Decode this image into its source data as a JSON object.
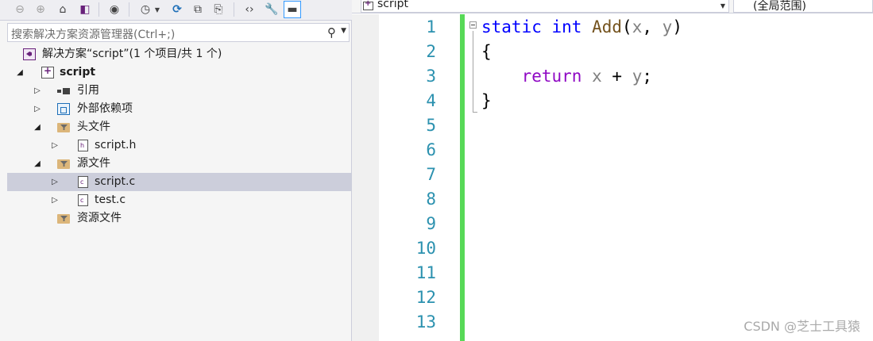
{
  "solution_explorer": {
    "search_placeholder": "搜索解决方案资源管理器(Ctrl+;)",
    "tree": [
      {
        "label": "解决方案“script”(1 个项目/共 1 个)",
        "icon": "solution-icon",
        "expander": "",
        "bold": false
      },
      {
        "label": "script",
        "icon": "project-icon",
        "expander": "expanded",
        "bold": true
      },
      {
        "label": "引用",
        "icon": "references-icon",
        "expander": "collapsed",
        "bold": false
      },
      {
        "label": "外部依赖项",
        "icon": "external-dependencies-icon",
        "expander": "collapsed",
        "bold": false
      },
      {
        "label": "头文件",
        "icon": "filter-folder-icon",
        "expander": "expanded",
        "bold": false
      },
      {
        "label": "script.h",
        "icon": "header-file-icon",
        "expander": "collapsed",
        "bold": false
      },
      {
        "label": "源文件",
        "icon": "filter-folder-icon",
        "expander": "expanded",
        "bold": false
      },
      {
        "label": "script.c",
        "icon": "c-file-icon",
        "expander": "collapsed",
        "bold": false,
        "selected": true
      },
      {
        "label": "test.c",
        "icon": "c-file-icon",
        "expander": "collapsed",
        "bold": false
      },
      {
        "label": "资源文件",
        "icon": "filter-folder-icon",
        "expander": "",
        "bold": false
      }
    ],
    "toolbar_icons": [
      "back-icon",
      "forward-icon",
      "home-icon",
      "switch-views-icon",
      "globe-icon",
      "pending-changes-icon",
      "refresh-icon",
      "collapse-all-icon",
      "show-all-files-icon",
      "view-code-icon",
      "properties-icon",
      "preview-icon"
    ]
  },
  "editor": {
    "file_dropdown": "script",
    "scope_dropdown": "(全局范围)",
    "line_numbers": [
      "1",
      "2",
      "3",
      "4",
      "5",
      "6",
      "7",
      "8",
      "9",
      "10",
      "11",
      "12",
      "13"
    ],
    "code": {
      "line1": {
        "kw_static": "static",
        "kw_int": "int",
        "fn": "Add",
        "open": "(",
        "p1": "x",
        "comma": ", ",
        "p2": "y",
        "close": ")"
      },
      "line2": "{",
      "line3": {
        "indent": "    ",
        "kw_return": "return",
        "p1": "x",
        "op": " + ",
        "p2": "y",
        "semi": ";"
      },
      "line4": "}"
    },
    "colors": {
      "keyword": "#0000ff",
      "control_keyword": "#8f08c4",
      "function": "#74531f",
      "parameter": "#808080",
      "line_number": "#2b91af",
      "change_bar": "#57d957"
    }
  },
  "watermark": "CSDN @芝士工具猿"
}
